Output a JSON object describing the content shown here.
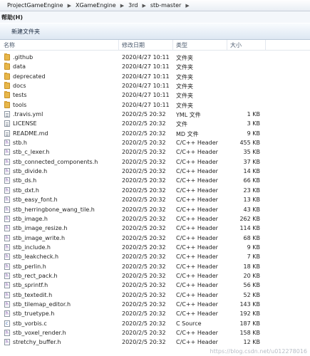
{
  "breadcrumb": [
    "ProjectGameEngine",
    "XGameEngine",
    "3rd",
    "stb-master"
  ],
  "menubar": {
    "help": "帮助(H)"
  },
  "toolbar": {
    "new_folder": "新建文件夹"
  },
  "columns": {
    "name": "名称",
    "date": "修改日期",
    "type": "类型",
    "size": "大小"
  },
  "files": [
    {
      "name": ".github",
      "date": "2020/4/27 10:11",
      "type": "文件夹",
      "size": "",
      "icon": "folder-icon"
    },
    {
      "name": "data",
      "date": "2020/4/27 10:11",
      "type": "文件夹",
      "size": "",
      "icon": "folder-icon"
    },
    {
      "name": "deprecated",
      "date": "2020/4/27 10:11",
      "type": "文件夹",
      "size": "",
      "icon": "folder-icon"
    },
    {
      "name": "docs",
      "date": "2020/4/27 10:11",
      "type": "文件夹",
      "size": "",
      "icon": "folder-icon"
    },
    {
      "name": "tests",
      "date": "2020/4/27 10:11",
      "type": "文件夹",
      "size": "",
      "icon": "folder-icon"
    },
    {
      "name": "tools",
      "date": "2020/4/27 10:11",
      "type": "文件夹",
      "size": "",
      "icon": "folder-icon"
    },
    {
      "name": ".travis.yml",
      "date": "2020/2/5 20:32",
      "type": "YML 文件",
      "size": "1 KB",
      "icon": "file-icon"
    },
    {
      "name": "LICENSE",
      "date": "2020/2/5 20:32",
      "type": "文件",
      "size": "3 KB",
      "icon": "file-icon"
    },
    {
      "name": "README.md",
      "date": "2020/2/5 20:32",
      "type": "MD 文件",
      "size": "9 KB",
      "icon": "file-icon"
    },
    {
      "name": "stb.h",
      "date": "2020/2/5 20:32",
      "type": "C/C++ Header",
      "size": "455 KB",
      "icon": "c-header-icon"
    },
    {
      "name": "stb_c_lexer.h",
      "date": "2020/2/5 20:32",
      "type": "C/C++ Header",
      "size": "35 KB",
      "icon": "c-header-icon"
    },
    {
      "name": "stb_connected_components.h",
      "date": "2020/2/5 20:32",
      "type": "C/C++ Header",
      "size": "37 KB",
      "icon": "c-header-icon"
    },
    {
      "name": "stb_divide.h",
      "date": "2020/2/5 20:32",
      "type": "C/C++ Header",
      "size": "14 KB",
      "icon": "c-header-icon"
    },
    {
      "name": "stb_ds.h",
      "date": "2020/2/5 20:32",
      "type": "C/C++ Header",
      "size": "66 KB",
      "icon": "c-header-icon"
    },
    {
      "name": "stb_dxt.h",
      "date": "2020/2/5 20:32",
      "type": "C/C++ Header",
      "size": "23 KB",
      "icon": "c-header-icon"
    },
    {
      "name": "stb_easy_font.h",
      "date": "2020/2/5 20:32",
      "type": "C/C++ Header",
      "size": "13 KB",
      "icon": "c-header-icon"
    },
    {
      "name": "stb_herringbone_wang_tile.h",
      "date": "2020/2/5 20:32",
      "type": "C/C++ Header",
      "size": "43 KB",
      "icon": "c-header-icon"
    },
    {
      "name": "stb_image.h",
      "date": "2020/2/5 20:32",
      "type": "C/C++ Header",
      "size": "262 KB",
      "icon": "c-header-icon"
    },
    {
      "name": "stb_image_resize.h",
      "date": "2020/2/5 20:32",
      "type": "C/C++ Header",
      "size": "114 KB",
      "icon": "c-header-icon"
    },
    {
      "name": "stb_image_write.h",
      "date": "2020/2/5 20:32",
      "type": "C/C++ Header",
      "size": "68 KB",
      "icon": "c-header-icon"
    },
    {
      "name": "stb_include.h",
      "date": "2020/2/5 20:32",
      "type": "C/C++ Header",
      "size": "9 KB",
      "icon": "c-header-icon"
    },
    {
      "name": "stb_leakcheck.h",
      "date": "2020/2/5 20:32",
      "type": "C/C++ Header",
      "size": "7 KB",
      "icon": "c-header-icon"
    },
    {
      "name": "stb_perlin.h",
      "date": "2020/2/5 20:32",
      "type": "C/C++ Header",
      "size": "18 KB",
      "icon": "c-header-icon"
    },
    {
      "name": "stb_rect_pack.h",
      "date": "2020/2/5 20:32",
      "type": "C/C++ Header",
      "size": "20 KB",
      "icon": "c-header-icon"
    },
    {
      "name": "stb_sprintf.h",
      "date": "2020/2/5 20:32",
      "type": "C/C++ Header",
      "size": "56 KB",
      "icon": "c-header-icon"
    },
    {
      "name": "stb_textedit.h",
      "date": "2020/2/5 20:32",
      "type": "C/C++ Header",
      "size": "52 KB",
      "icon": "c-header-icon"
    },
    {
      "name": "stb_tilemap_editor.h",
      "date": "2020/2/5 20:32",
      "type": "C/C++ Header",
      "size": "143 KB",
      "icon": "c-header-icon"
    },
    {
      "name": "stb_truetype.h",
      "date": "2020/2/5 20:32",
      "type": "C/C++ Header",
      "size": "192 KB",
      "icon": "c-header-icon"
    },
    {
      "name": "stb_vorbis.c",
      "date": "2020/2/5 20:32",
      "type": "C Source",
      "size": "187 KB",
      "icon": "c-source-icon"
    },
    {
      "name": "stb_voxel_render.h",
      "date": "2020/2/5 20:32",
      "type": "C/C++ Header",
      "size": "158 KB",
      "icon": "c-header-icon"
    },
    {
      "name": "stretchy_buffer.h",
      "date": "2020/2/5 20:32",
      "type": "C/C++ Header",
      "size": "12 KB",
      "icon": "c-header-icon"
    }
  ],
  "watermark": "https://blog.csdn.net/u012278016"
}
